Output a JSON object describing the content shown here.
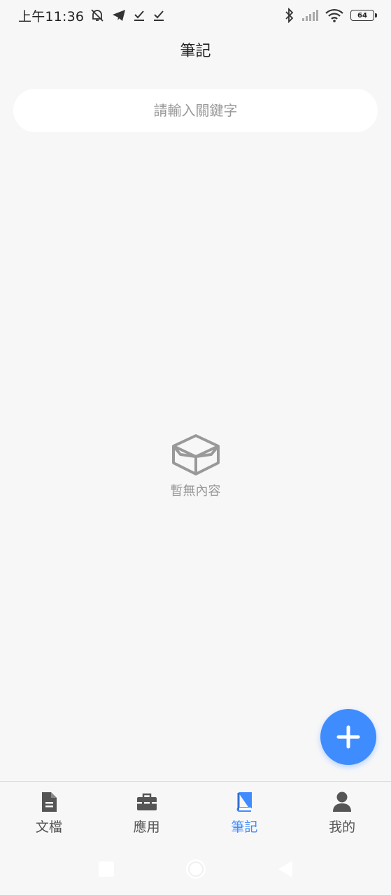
{
  "status_bar": {
    "time": "上午11:36",
    "battery": "64",
    "icons_left": [
      "muted-bell-icon",
      "telegram-icon",
      "check-icon",
      "check-icon"
    ],
    "icons_right": [
      "bluetooth-icon",
      "signal-icon",
      "wifi-icon",
      "battery-icon"
    ]
  },
  "header": {
    "title": "筆記"
  },
  "search": {
    "placeholder": "請輸入關鍵字",
    "value": ""
  },
  "empty_state": {
    "icon": "empty-box-icon",
    "text": "暫無內容"
  },
  "fab": {
    "icon": "plus-icon",
    "color": "#3f8cff"
  },
  "tabs": [
    {
      "label": "文檔",
      "icon": "document-icon",
      "active": false
    },
    {
      "label": "應用",
      "icon": "toolbox-icon",
      "active": false
    },
    {
      "label": "筆記",
      "icon": "notebook-icon",
      "active": true
    },
    {
      "label": "我的",
      "icon": "person-icon",
      "active": false
    }
  ],
  "colors": {
    "accent": "#3f8cff",
    "background": "#f7f7f8",
    "muted": "#999999"
  },
  "system_nav": [
    "recents-square-icon",
    "home-circle-icon",
    "back-triangle-icon"
  ]
}
